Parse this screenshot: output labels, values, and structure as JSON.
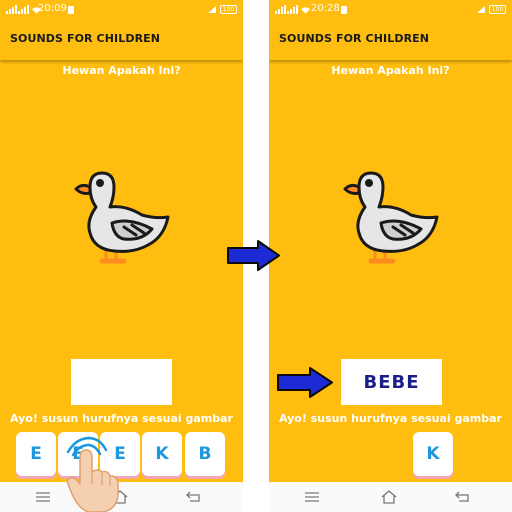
{
  "left_screen": {
    "status": {
      "time": "20:09",
      "battery": "100"
    },
    "app_title": "SOUNDS FOR CHILDREN",
    "question": "Hewan Apakah Ini?",
    "answer": "",
    "instruction": "Ayo! susun hurufnya sesuai gambar",
    "letters": [
      "E",
      "E",
      "E",
      "K",
      "B"
    ]
  },
  "right_screen": {
    "status": {
      "time": "20:28",
      "battery": "100"
    },
    "app_title": "SOUNDS FOR CHILDREN",
    "question": "Hewan Apakah Ini?",
    "answer": "BEBE",
    "instruction": "Ayo! susun hurufnya sesuai gambar",
    "letters": [
      "K"
    ]
  },
  "icons": {
    "animal": "duck-icon",
    "tap_gesture": "hand-pointer-icon",
    "nav_menu": "menu-lines-icon",
    "nav_home": "home-icon",
    "nav_back": "back-icon",
    "arrow": "arrow-right-icon"
  },
  "colors": {
    "background": "#FFBE0F",
    "letter": "#1e97de",
    "answer_text": "#1b1e87",
    "arrow": "#1c2bd4",
    "tile_shadow": "#f1a6b8"
  }
}
